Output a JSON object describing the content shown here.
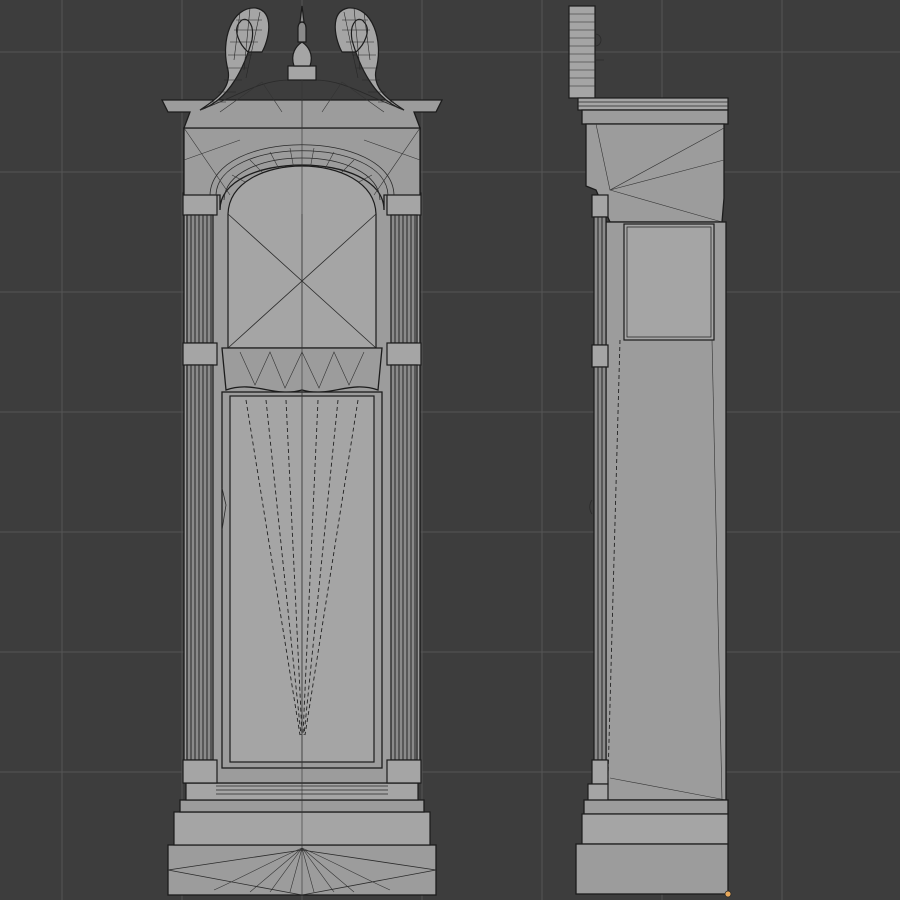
{
  "viewport": {
    "background_color": "#3d3d3d",
    "grid_color": "#555555",
    "mesh_fill_color": "#9c9c9c",
    "wire_color": "#1c1c1c",
    "vertex_marker_color": "#e8a85a"
  },
  "objects": [
    {
      "name": "grandfather-clock-front-view"
    },
    {
      "name": "grandfather-clock-side-view"
    }
  ]
}
